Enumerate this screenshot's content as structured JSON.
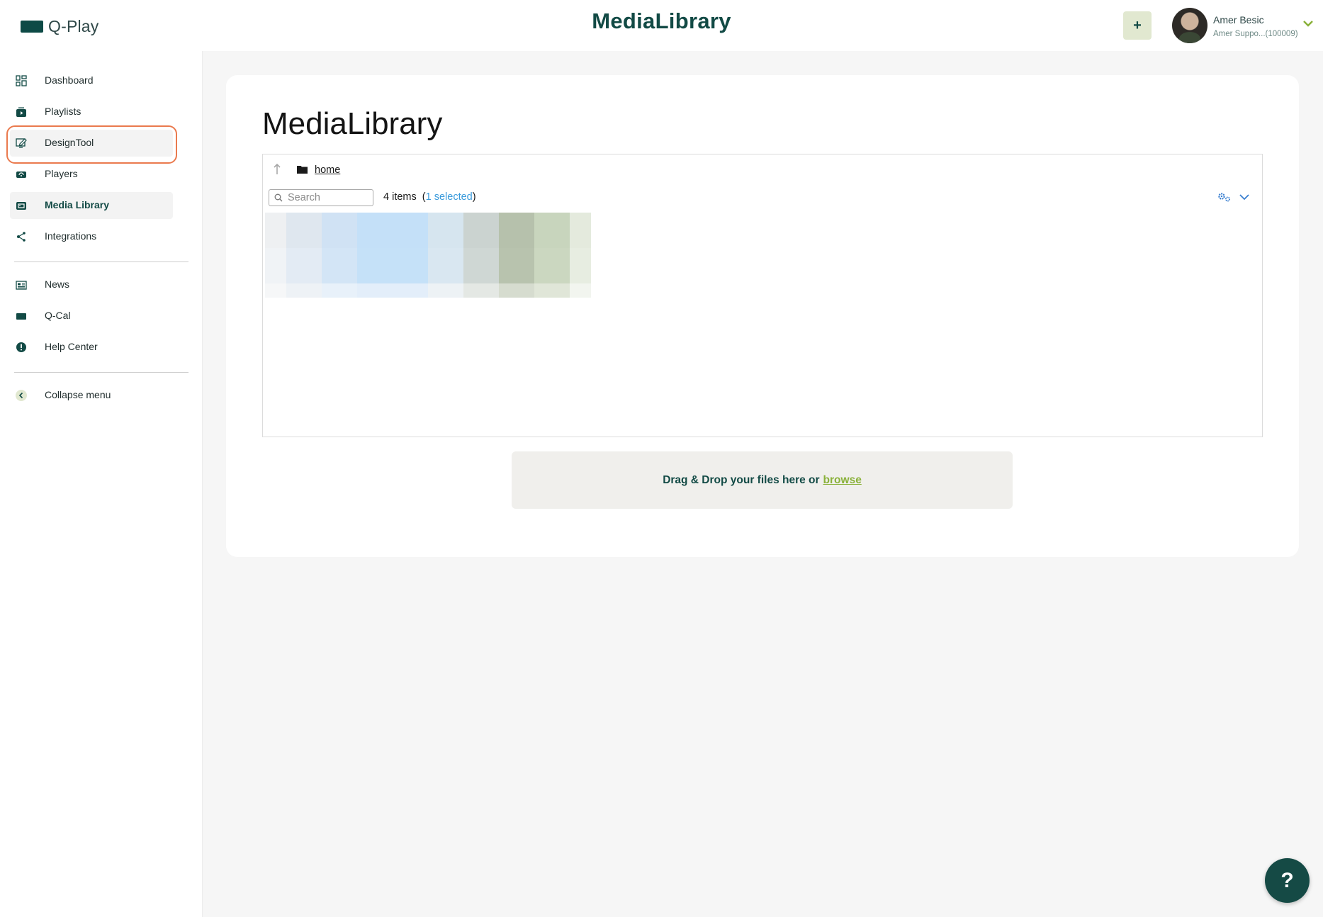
{
  "app": {
    "logo_text": "Q-Play",
    "header_title": "MediaLibrary"
  },
  "header": {
    "add_label": "+"
  },
  "user": {
    "name": "Amer Besic",
    "subtitle": "Amer Suppo...(100009)"
  },
  "sidebar": {
    "items": [
      {
        "label": "Dashboard",
        "icon": "dashboard-icon"
      },
      {
        "label": "Playlists",
        "icon": "playlist-icon"
      },
      {
        "label": "DesignTool",
        "icon": "design-tool-icon"
      },
      {
        "label": "Players",
        "icon": "player-icon"
      },
      {
        "label": "Media Library",
        "icon": "media-library-icon",
        "active": true
      },
      {
        "label": "Integrations",
        "icon": "share-icon"
      }
    ],
    "secondary": [
      {
        "label": "News",
        "icon": "news-icon"
      },
      {
        "label": "Q-Cal",
        "icon": "calendar-icon"
      },
      {
        "label": "Help Center",
        "icon": "help-icon"
      }
    ],
    "collapse_label": "Collapse menu"
  },
  "main": {
    "title": "MediaLibrary",
    "file_manager": {
      "breadcrumb": "home",
      "search_placeholder": "Search",
      "item_count": "4 items",
      "selected": "1 selected"
    },
    "dropzone": {
      "text": "Drag & Drop your files here or",
      "browse_label": "browse"
    }
  },
  "help_fab_label": "?",
  "colors": {
    "brand": "#124a45",
    "accent_green": "#8ab13a",
    "link_blue": "#3a9bdc",
    "highlight": "#ea7a4e"
  }
}
